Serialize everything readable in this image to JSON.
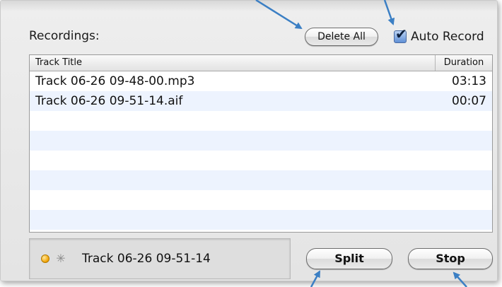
{
  "recordings": {
    "label": "Recordings:",
    "delete_all_label": "Delete All",
    "auto_record": {
      "label": "Auto Record",
      "checked": true,
      "check_glyph": "✔"
    }
  },
  "table": {
    "columns": {
      "title": "Track Title",
      "duration": "Duration"
    },
    "rows": [
      {
        "title": "Track 06-26 09-48-00.mp3",
        "duration": "03:13"
      },
      {
        "title": "Track 06-26 09-51-14.aif",
        "duration": "00:07"
      }
    ]
  },
  "status": {
    "current_track": "Track 06-26 09-51-14",
    "indicator_color": "#f1a100",
    "spinner_glyph": "✳"
  },
  "controls": {
    "split_label": "Split",
    "stop_label": "Stop"
  },
  "colors": {
    "annotation_arrow": "#3b7fc4",
    "row_alt": "#edf3fe",
    "checkbox": "#5f8fd6"
  }
}
